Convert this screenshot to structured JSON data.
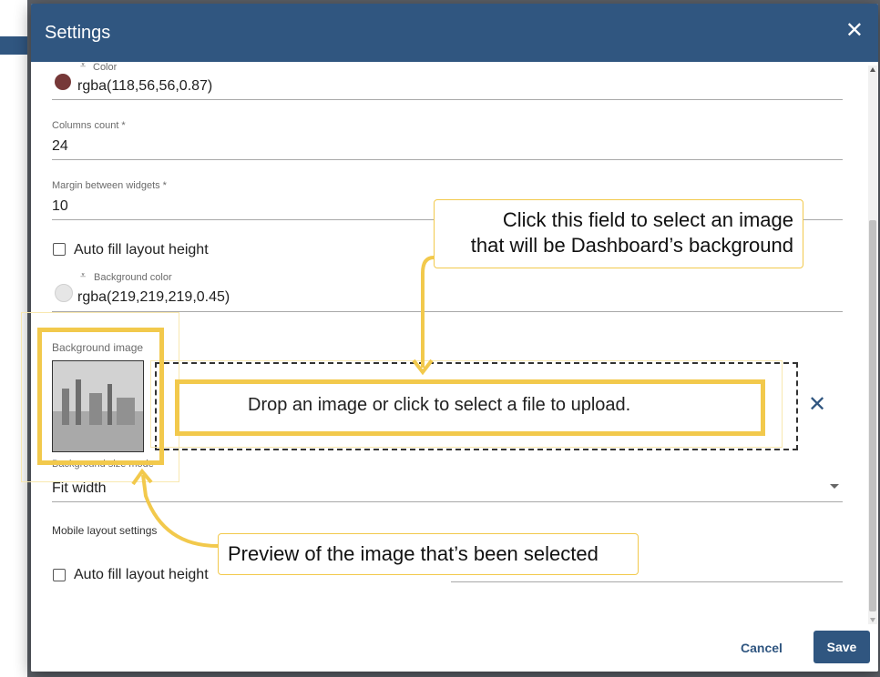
{
  "dialog": {
    "title": "Settings",
    "close_icon": "close-icon"
  },
  "fields": {
    "color": {
      "label": "Color",
      "value": "rgba(118,56,56,0.87)",
      "swatch": "#763838"
    },
    "columns_count": {
      "label": "Columns count *",
      "value": "24"
    },
    "margin": {
      "label": "Margin between widgets *",
      "value": "10"
    },
    "auto_fill": {
      "label": "Auto fill layout height",
      "checked": false
    },
    "background_color": {
      "label": "Background color",
      "value": "rgba(219,219,219,0.45)",
      "swatch": "#dbdbdb"
    },
    "background_image": {
      "label": "Background image",
      "drop_text": "Drop an image or click to select a file to upload."
    },
    "background_size_mode": {
      "label": "Background size mode",
      "value": "Fit width"
    },
    "mobile_layout": {
      "label": "Mobile layout settings"
    },
    "mobile_auto_fill": {
      "label": "Auto fill layout height",
      "checked": false
    }
  },
  "footer": {
    "cancel_label": "Cancel",
    "save_label": "Save"
  },
  "callouts": {
    "select_image": [
      "Click this field to select an image",
      "that will be Dashboard’s background"
    ],
    "preview": "Preview of the image that’s been selected"
  },
  "colors": {
    "header": "#305680",
    "accent": "#f2c94c"
  }
}
